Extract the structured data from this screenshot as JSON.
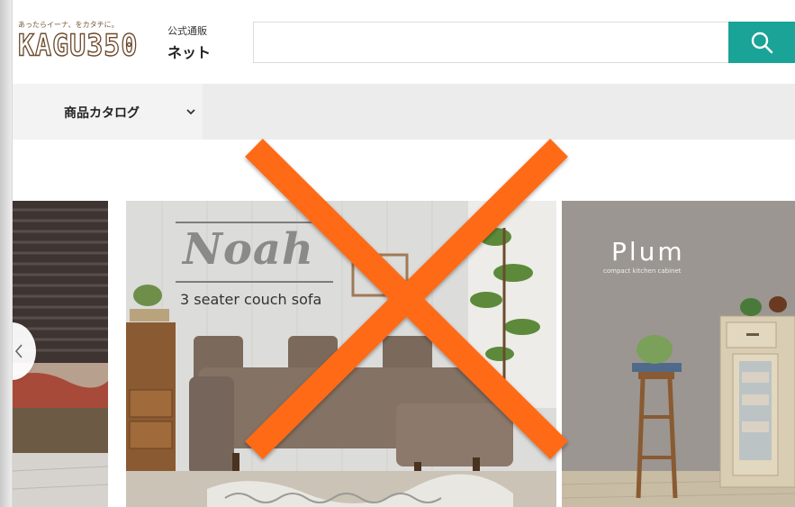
{
  "header": {
    "logo_tagline": "あったらイーナ、をカタチに。",
    "logo_text": "KAGU350",
    "shop_label_sub": "公式通販",
    "shop_label_main": "ネット",
    "search": {
      "placeholder": "",
      "value": ""
    }
  },
  "nav": {
    "category_label": "商品カタログ"
  },
  "carousel": {
    "slides": [
      {
        "title": "",
        "subtitle": ""
      },
      {
        "title": "Noah",
        "subtitle": "3 seater couch sofa"
      },
      {
        "title": "Plum",
        "subtitle": "compact kitchen cabinet"
      }
    ]
  },
  "colors": {
    "search_button": "#1aa397",
    "overlay_x": "#ff6a13",
    "nav_bar": "#ececec"
  },
  "icons": {
    "search": "search-icon",
    "category_dropdown": "chevron-down-icon",
    "carousel_prev": "chevron-left-icon",
    "overlay": "cross-mark-icon"
  }
}
